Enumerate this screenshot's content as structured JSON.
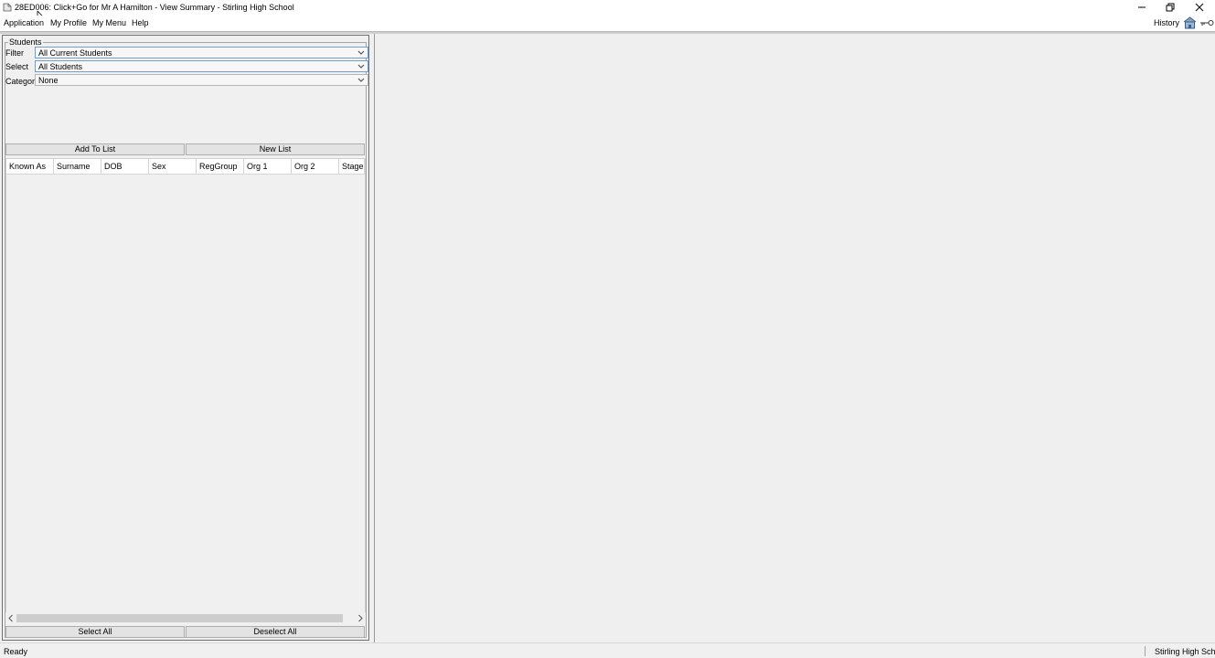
{
  "window": {
    "title": "28ED006: Click+Go for Mr A Hamilton - View Summary - Stirling High School",
    "icons": {
      "app": "document-icon",
      "minimize": "minimize-icon",
      "maximize": "restore-icon",
      "close": "close-icon"
    }
  },
  "menu": {
    "items": [
      "Application",
      "My Profile",
      "My Menu",
      "Help"
    ],
    "history": "History",
    "icons": {
      "home": "home-icon",
      "logout": "key-icon"
    }
  },
  "students_panel": {
    "legend": "Students",
    "filter": {
      "label": "Filter",
      "value": "All Current Students"
    },
    "select": {
      "label": "Select",
      "value": "All Students"
    },
    "category": {
      "label": "Category",
      "value": "None"
    },
    "add_to_list": "Add To List",
    "new_list": "New List",
    "columns": [
      "Known As",
      "Surname",
      "DOB",
      "Sex",
      "RegGroup",
      "Org 1",
      "Org 2",
      "Stage"
    ],
    "select_all": "Select All",
    "deselect_all": "Deselect All"
  },
  "status": {
    "text": "Ready",
    "school": "Stirling High School"
  },
  "colors": {
    "dropdown_border_focus": "#7a9cc6",
    "panel_background": "#f0f0f0"
  }
}
